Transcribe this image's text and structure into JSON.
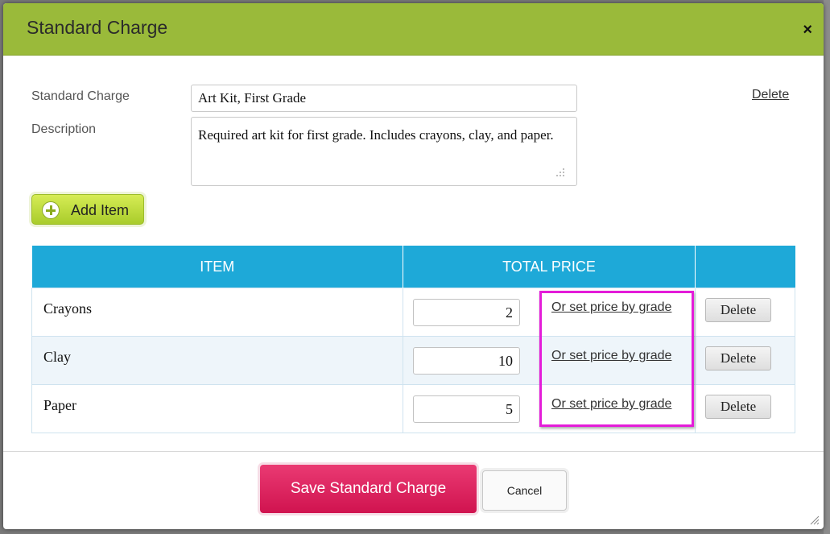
{
  "dialog": {
    "title": "Standard Charge",
    "close_symbol": "×"
  },
  "form": {
    "charge_label": "Standard Charge",
    "charge_value": "Art Kit, First Grade",
    "description_label": "Description",
    "description_value": "Required art kit for first grade. Includes crayons, clay, and paper.",
    "delete_link": "Delete"
  },
  "add_item": {
    "label": "Add Item",
    "icon": "plus-circle-icon"
  },
  "items_table": {
    "headers": [
      "ITEM",
      "TOTAL PRICE",
      ""
    ],
    "rows": [
      {
        "item": "Crayons",
        "price": "2",
        "grade_link": "Or set price by grade",
        "delete": "Delete"
      },
      {
        "item": "Clay",
        "price": "10",
        "grade_link": "Or set price by grade",
        "delete": "Delete"
      },
      {
        "item": "Paper",
        "price": "5",
        "grade_link": "Or set price by grade",
        "delete": "Delete"
      }
    ]
  },
  "footer": {
    "save_label": "Save Standard Charge",
    "cancel_label": "Cancel"
  },
  "colors": {
    "header_green": "#9aba3a",
    "table_header_blue": "#1ea9d8",
    "save_pink": "#d0134f",
    "highlight_magenta": "#e41cd9"
  }
}
